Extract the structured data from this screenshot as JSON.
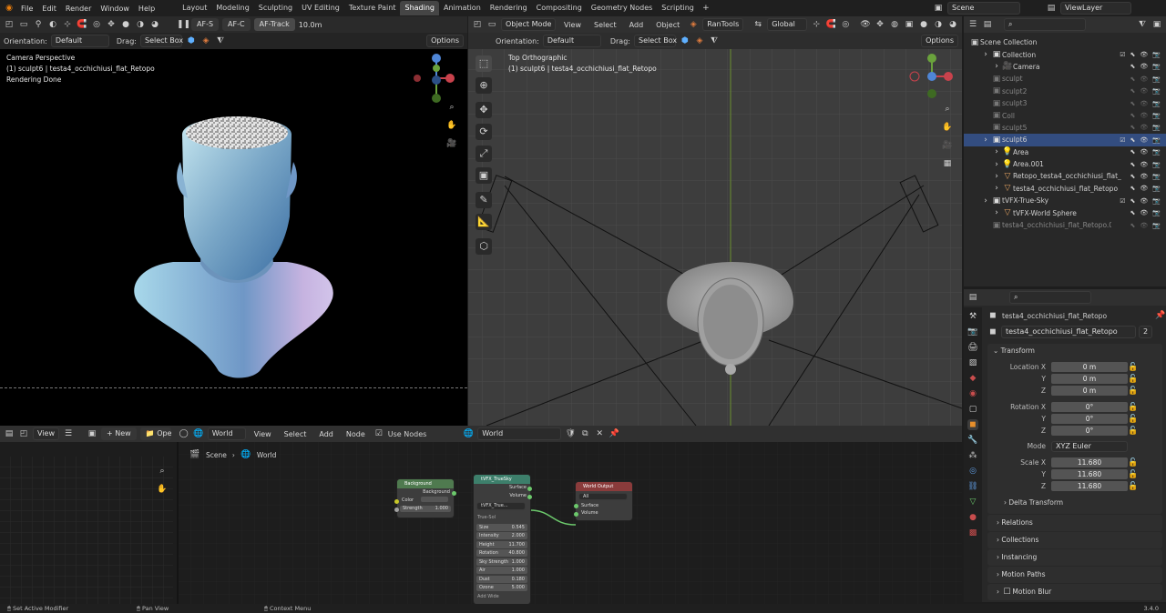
{
  "topbar": {
    "menus": [
      "File",
      "Edit",
      "Render",
      "Window",
      "Help"
    ],
    "workspaces": [
      "Layout",
      "Modeling",
      "Sculpting",
      "UV Editing",
      "Texture Paint",
      "Shading",
      "Animation",
      "Rendering",
      "Compositing",
      "Geometry Nodes",
      "Scripting"
    ],
    "active_workspace": "Shading",
    "scene": "Scene",
    "view_layer": "ViewLayer",
    "af_s": "AF-S",
    "af_c": "AF-C",
    "af_track": "AF-Track",
    "distance": "10.0m"
  },
  "left_viewport": {
    "orientation_label": "Orientation:",
    "orientation": "Default",
    "drag_label": "Drag:",
    "drag": "Select Box",
    "options": "Options",
    "overlay_lines": [
      "Camera Perspective",
      "(1) sculpt6 | testa4_occhichiusi_flat_Retopo",
      "Rendering Done"
    ]
  },
  "right_viewport": {
    "mode": "Object Mode",
    "menus": [
      "View",
      "Select",
      "Add",
      "Object"
    ],
    "raintools": "RanTools",
    "transform": "Global",
    "orientation_label": "Orientation:",
    "orientation": "Default",
    "drag_label": "Drag:",
    "drag": "Select Box",
    "options": "Options",
    "overlay_lines": [
      "Top Orthographic",
      "(1) sculpt6 | testa4_occhichiusi_flat_Retopo"
    ]
  },
  "outliner": {
    "root": "Scene Collection",
    "items": [
      {
        "label": "Collection",
        "indent": 1,
        "type": "coll"
      },
      {
        "label": "Camera",
        "indent": 2,
        "type": "cam"
      },
      {
        "label": "sculpt",
        "indent": 1,
        "type": "dim"
      },
      {
        "label": "sculpt2",
        "indent": 1,
        "type": "dim"
      },
      {
        "label": "sculpt3",
        "indent": 1,
        "type": "dim"
      },
      {
        "label": "Coll",
        "indent": 1,
        "type": "dim"
      },
      {
        "label": "sculpt5",
        "indent": 1,
        "type": "dim"
      },
      {
        "label": "sculpt6",
        "indent": 1,
        "type": "coll-sel"
      },
      {
        "label": "Area",
        "indent": 2,
        "type": "light"
      },
      {
        "label": "Area.001",
        "indent": 2,
        "type": "light"
      },
      {
        "label": "Retopo_testa4_occhichiusi_flat_",
        "indent": 2,
        "type": "mesh"
      },
      {
        "label": "testa4_occhichiusi_flat_Retopo",
        "indent": 2,
        "type": "mesh"
      },
      {
        "label": "tVFX-True-Sky",
        "indent": 1,
        "type": "coll"
      },
      {
        "label": "tVFX-World Sphere",
        "indent": 2,
        "type": "mesh"
      },
      {
        "label": "testa4_occhichiusi_flat_Retopo.001",
        "indent": 1,
        "type": "dim"
      }
    ]
  },
  "properties": {
    "object_name": "testa4_occhichiusi_flat_Retopo",
    "datablock": "testa4_occhichiusi_flat_Retopo",
    "users": "2",
    "transform_title": "Transform",
    "location_label": "Location X",
    "rotation_label": "Rotation X",
    "scale_label": "Scale X",
    "axis_y": "Y",
    "axis_z": "Z",
    "location": [
      "0 m",
      "0 m",
      "0 m"
    ],
    "rotation": [
      "0°",
      "0°",
      "0°"
    ],
    "mode_label": "Mode",
    "mode": "XYZ Euler",
    "scale": [
      "11.680",
      "11.680",
      "11.680"
    ],
    "subsections": [
      "Delta Transform",
      "Relations",
      "Collections",
      "Instancing",
      "Motion Paths",
      "Motion Blur"
    ]
  },
  "node_editor": {
    "view": "View",
    "new": "New",
    "open": "Open",
    "world_type": "World",
    "menus": [
      "View",
      "Select",
      "Add",
      "Node"
    ],
    "use_nodes": "Use Nodes",
    "world_name": "World",
    "breadcrumb": [
      "Scene",
      "World"
    ],
    "background_node": {
      "title": "Background",
      "out": "Background",
      "color": "Color",
      "strength_label": "Strength",
      "strength": "1.000"
    },
    "sky_node": {
      "title": "tVFX_TrueSky",
      "surface": "Surface",
      "volume": "Volume",
      "group": "tVFX_True...",
      "section": "True-Sol",
      "fields": [
        [
          "Size",
          "0.545"
        ],
        [
          "Intensity",
          "2.000"
        ],
        [
          "Height",
          "11.700"
        ],
        [
          "Rotation",
          "40.800"
        ],
        [
          "Sky Strength",
          "1.000"
        ],
        [
          "Air",
          "1.000"
        ],
        [
          "Dust",
          "0.180"
        ],
        [
          "Ozone",
          "5.000"
        ]
      ],
      "footer": "Add Wide"
    },
    "output_node": {
      "title": "World Output",
      "target": "All",
      "surface": "Surface",
      "volume": "Volume"
    }
  },
  "statusbar": {
    "left": "Set Active Modifier",
    "mid1": "Pan View",
    "mid2": "Context Menu",
    "version": "3.4.0"
  }
}
